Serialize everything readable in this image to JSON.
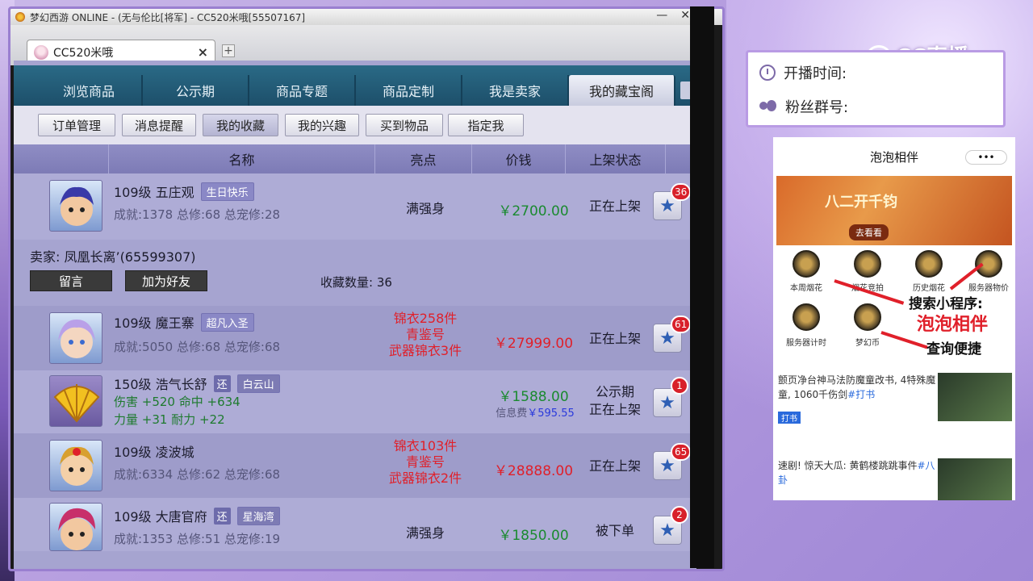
{
  "window": {
    "title": "梦幻西游 ONLINE - (无与伦比[将军] - CC520米哦[55507167]",
    "minimize": "—",
    "close": "✕"
  },
  "browser": {
    "tab_label": "CC520米哦",
    "tab_close": "×",
    "new_tab": "+"
  },
  "nav": {
    "tabs": [
      "浏览商品",
      "公示期",
      "商品专题",
      "商品定制",
      "我是卖家",
      "我的藏宝阁"
    ],
    "active_index": 5
  },
  "subnav": {
    "buttons": [
      "订单管理",
      "消息提醒",
      "我的收藏",
      "我的兴趣",
      "买到物品",
      "指定我"
    ],
    "active_index": 2
  },
  "table": {
    "headers": [
      "名称",
      "亮点",
      "价钱",
      "上架状态"
    ],
    "rows": [
      {
        "level_name": "109级 五庄观",
        "tag": "生日快乐",
        "stats": "成就:1378 总修:68 总宠修:28",
        "highlight": "满强身",
        "price": "￥2700.00",
        "status": "正在上架",
        "fav_count": "36"
      },
      {
        "level_name": "109级 魔王寨",
        "tag": "超凡入圣",
        "stats": "成就:5050 总修:68 总宠修:68",
        "highlight_lines": [
          "锦衣258件",
          "青鉴号",
          "武器锦衣3件"
        ],
        "price": "￥27999.00",
        "status": "正在上架",
        "fav_count": "61"
      },
      {
        "level_name": "150级 浩气长舒",
        "huan": "还",
        "tag": "白云山",
        "stats_line1": "伤害 +520 命中 +634",
        "stats_line2": "力量 +31 耐力 +22",
        "price": "￥1588.00",
        "price_sub_label": "信息费",
        "price_sub_value": "￥595.55",
        "status_lines": [
          "公示期",
          "正在上架"
        ],
        "fav_count": "1"
      },
      {
        "level_name": "109级 凌波城",
        "stats": "成就:6334 总修:62 总宠修:68",
        "highlight_lines": [
          "锦衣103件",
          "青鉴号",
          "武器锦衣2件"
        ],
        "price": "￥28888.00",
        "status": "正在上架",
        "fav_count": "65"
      },
      {
        "level_name": "109级 大唐官府",
        "huan": "还",
        "tag": "星海湾",
        "stats": "成就:1353 总修:51 总宠修:19",
        "highlight": "满强身",
        "price": "￥1850.00",
        "status": "被下单",
        "fav_count": "2"
      }
    ]
  },
  "seller": {
    "label": "卖家: 凤凰长离’(65599307)",
    "message_button": "留言",
    "add_friend_button": "加为好友",
    "fav_qty": "收藏数量: 36"
  },
  "overlay": {
    "live_time_label": "开播时间:",
    "fans_group_label": "粉丝群号:",
    "logo_text": "CC直播"
  },
  "phone": {
    "title": "泡泡相伴",
    "menu": "•••",
    "banner_text": "八二开千钧",
    "banner_button": "去看看",
    "grid": [
      "本周烟花",
      "烟花竞拍",
      "历史烟花",
      "服务器物价",
      "服务器计时",
      "梦幻币"
    ],
    "promo_1": "搜索小程序:",
    "promo_2": "泡泡相伴",
    "promo_3": "查询便捷",
    "news": [
      {
        "text": "颤页净台神马法防魔童改书, 4特殊魔童, 1060千伤剑",
        "hash": "#打书",
        "tag": "打书"
      },
      {
        "text": "速剧! 惊天大瓜: 黄鹤楼跳跳事件",
        "hash": "#八卦",
        "tag": ""
      }
    ]
  },
  "colors": {
    "nav_bg": "#1d4f6a",
    "price_green": "#1b8a30",
    "price_red": "#e0202a",
    "badge_red": "#d8202a",
    "frame": "#9a7fd0"
  }
}
